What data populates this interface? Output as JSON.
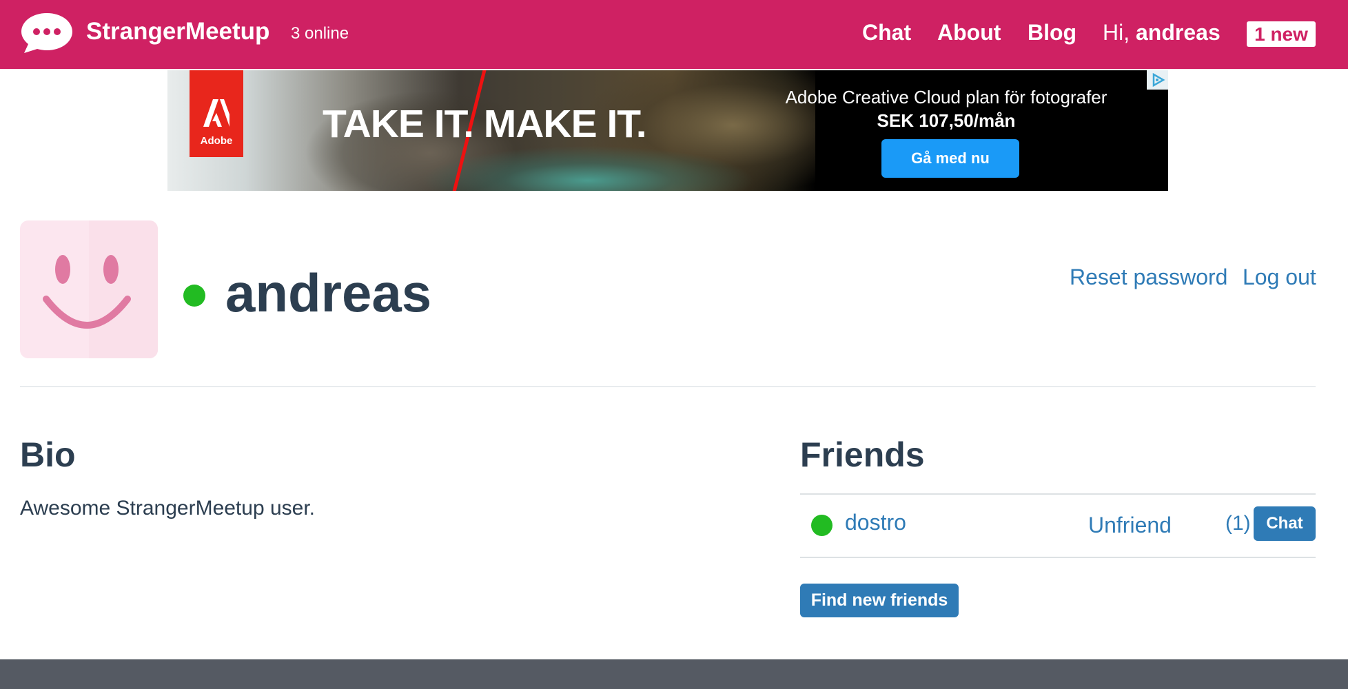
{
  "header": {
    "brand": "StrangerMeetup",
    "online": "3 online",
    "nav": {
      "chat": "Chat",
      "about": "About",
      "blog": "Blog"
    },
    "greeting_prefix": "Hi,",
    "greeting_user": "andreas",
    "notifications": "1 new",
    "logo_icon": "speech-bubble-icon"
  },
  "ad": {
    "brand": "Adobe",
    "headline": "TAKE IT. MAKE IT.",
    "line1": "Adobe Creative Cloud plan för fotografer",
    "line2": "SEK 107,50/mån",
    "cta": "Gå med nu",
    "choices_icon": "adchoices-icon"
  },
  "profile": {
    "username": "andreas",
    "status": "online",
    "avatar_icon": "smiley-face-icon",
    "reset_password": "Reset password",
    "log_out": "Log out"
  },
  "bio": {
    "heading": "Bio",
    "text": "Awesome StrangerMeetup user."
  },
  "friends": {
    "heading": "Friends",
    "list": [
      {
        "name": "dostro",
        "status": "online",
        "unfriend": "Unfriend",
        "count": "(1)",
        "chat": "Chat"
      }
    ],
    "find_new": "Find new friends"
  },
  "colors": {
    "brand": "#cf2163",
    "link": "#2f7bb6",
    "online": "#22bb22",
    "text": "#2c3e50",
    "footer": "#555a63"
  }
}
